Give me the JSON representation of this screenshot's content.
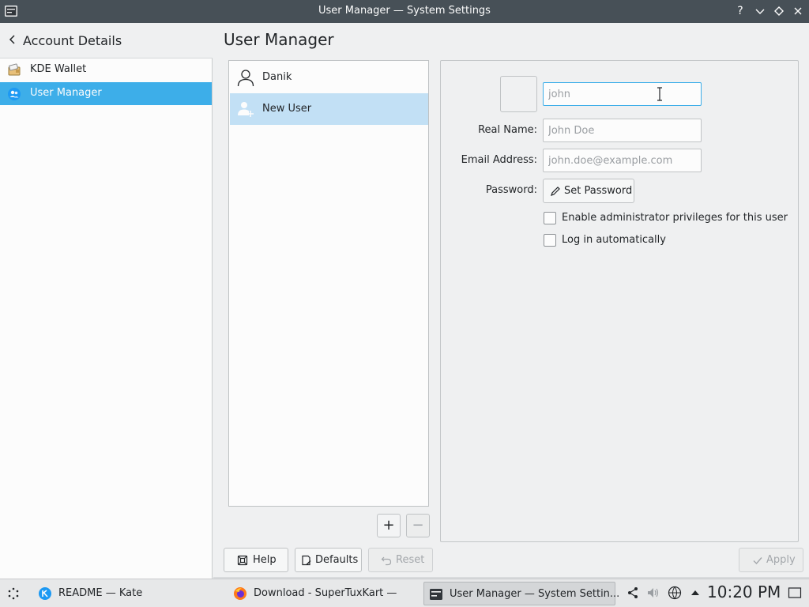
{
  "window": {
    "title": "User Manager — System Settings",
    "help_glyph": "?",
    "minimize_glyph": "⌄",
    "maximize_glyph": "◇",
    "close_glyph": "✕"
  },
  "sidebar": {
    "back_title": "Account Details",
    "items": [
      {
        "label": "KDE Wallet",
        "icon": "wallet-icon",
        "active": false
      },
      {
        "label": "User Manager",
        "icon": "user-manager-icon",
        "active": true
      }
    ]
  },
  "page": {
    "title": "User Manager"
  },
  "users": [
    {
      "name": "Danik",
      "icon": "user-icon",
      "selected": false
    },
    {
      "name": "New User",
      "icon": "new-user-icon",
      "selected": true
    }
  ],
  "list_tools": {
    "add_glyph": "+",
    "remove_glyph": "−"
  },
  "form": {
    "username": {
      "value": "",
      "placeholder": "john"
    },
    "real_name": {
      "label": "Real Name:",
      "value": "",
      "placeholder": "John Doe"
    },
    "email": {
      "label": "Email Address:",
      "value": "",
      "placeholder": "john.doe@example.com"
    },
    "password": {
      "label": "Password:",
      "button_label": "Set Password"
    },
    "admin_checkbox": {
      "label": "Enable administrator privileges for this user",
      "checked": false
    },
    "autologin_checkbox": {
      "label": "Log in automatically",
      "checked": false
    }
  },
  "footer": {
    "help_label": "Help",
    "defaults_label": "Defaults",
    "reset_label": "Reset",
    "apply_label": "Apply"
  },
  "taskbar": {
    "tasks": [
      {
        "label": "README  — Kate",
        "icon": "kate-icon",
        "active": false
      },
      {
        "label": "Download - SuperTuxKart —",
        "icon": "firefox-icon",
        "active": false
      },
      {
        "label": "User Manager  — System Settin...",
        "icon": "system-settings-icon",
        "active": true
      }
    ],
    "clock": "10:20 PM"
  },
  "colors": {
    "accent": "#3daee9",
    "selection": "#c2e0f5",
    "titlebar": "#475057",
    "window_bg": "#eff0f1"
  }
}
